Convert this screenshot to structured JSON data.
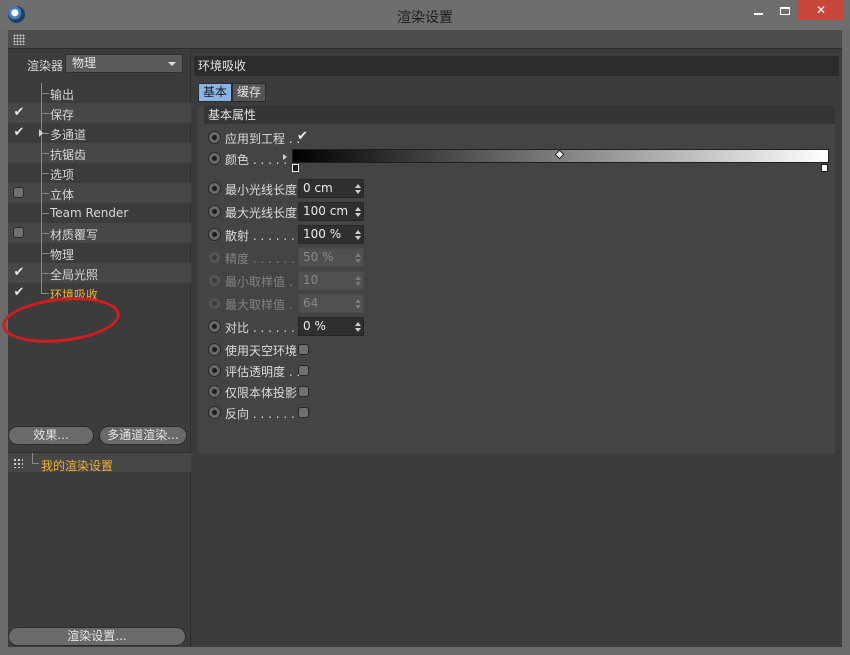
{
  "window": {
    "title": "渲染设置"
  },
  "left_panel": {
    "renderer_label": "渲染器",
    "renderer_value": "物理",
    "tree": [
      {
        "label": "输出",
        "state": "none"
      },
      {
        "label": "保存",
        "state": "checked"
      },
      {
        "label": "多通道",
        "state": "checked",
        "expandable": true
      },
      {
        "label": "抗锯齿",
        "state": "none"
      },
      {
        "label": "选项",
        "state": "none"
      },
      {
        "label": "立体",
        "state": "unchecked"
      },
      {
        "label": "Team Render",
        "state": "none"
      },
      {
        "label": "材质覆写",
        "state": "unchecked"
      },
      {
        "label": "物理",
        "state": "none"
      },
      {
        "label": "全局光照",
        "state": "checked"
      },
      {
        "label": "环境吸收",
        "state": "checked",
        "active": true
      }
    ],
    "effects_button": "效果...",
    "multipass_button": "多通道渲染...",
    "settings_item": "我的渲染设置",
    "render_settings_button": "渲染设置..."
  },
  "right_panel": {
    "header": "环境吸收",
    "tabs": [
      "基本",
      "缓存"
    ],
    "group_title": "基本属性",
    "apply_to_project": {
      "label": "应用到工程 . .",
      "checked": true
    },
    "color": {
      "label": "颜色 . . . . .",
      "gradient": [
        "#000000",
        "#ffffff"
      ]
    },
    "min_ray_length": {
      "label": "最小光线长度",
      "value": "0 cm"
    },
    "max_ray_length": {
      "label": "最大光线长度",
      "value": "100 cm"
    },
    "dispersion": {
      "label": "散射 . . . . . . .",
      "value": "100 %"
    },
    "accuracy": {
      "label": "精度 . . . . . . .",
      "value": "50 %"
    },
    "min_samples": {
      "label": "最小取样值 . .",
      "value": "10"
    },
    "max_samples": {
      "label": "最大取样值 . .",
      "value": "64"
    },
    "contrast": {
      "label": "对比 . . . . . . .",
      "value": "0 %"
    },
    "use_sky": {
      "label": "使用天空环境",
      "checked": false
    },
    "eval_transparency": {
      "label": "评估透明度 . .",
      "checked": false
    },
    "self_shadow_only": {
      "label": "仅限本体投影",
      "checked": false
    },
    "invert": {
      "label": "反向 . . . . . . .",
      "checked": false
    }
  }
}
